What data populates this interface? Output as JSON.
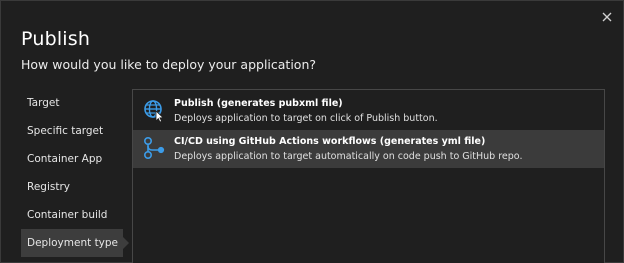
{
  "dialog": {
    "title": "Publish",
    "subtitle": "How would you like to deploy your application?",
    "close_icon": "close-icon"
  },
  "sidebar": {
    "items": [
      {
        "label": "Target",
        "selected": false
      },
      {
        "label": "Specific target",
        "selected": false
      },
      {
        "label": "Container App",
        "selected": false
      },
      {
        "label": "Registry",
        "selected": false
      },
      {
        "label": "Container build",
        "selected": false
      },
      {
        "label": "Deployment type",
        "selected": true
      }
    ]
  },
  "options": [
    {
      "icon": "globe-publish-icon",
      "title": "Publish (generates pubxml file)",
      "description": "Deploys application to target on click of Publish button.",
      "highlighted": false
    },
    {
      "icon": "github-actions-workflow-icon",
      "title": "CI/CD using GitHub Actions workflows (generates yml file)",
      "description": "Deploys application to target automatically on code push to GitHub repo.",
      "highlighted": true
    }
  ],
  "colors": {
    "background": "#1f1f1f",
    "selected_background": "#3d3d3d",
    "icon_blue": "#3c9ce8"
  }
}
